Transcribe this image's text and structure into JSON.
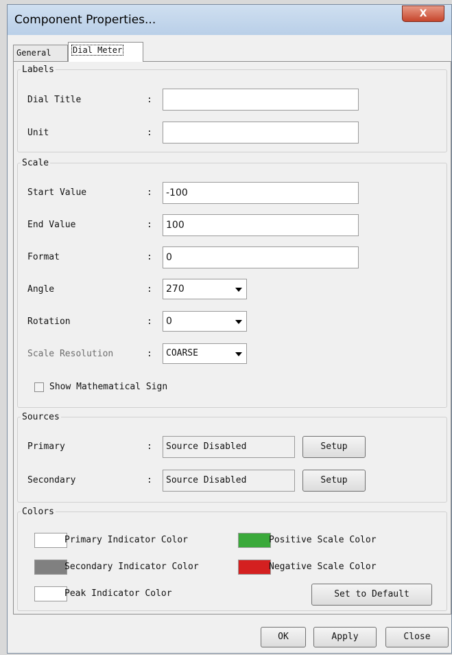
{
  "window": {
    "title": "Component Properties...",
    "close_glyph": "X"
  },
  "tabs": [
    {
      "label": "General",
      "active": false
    },
    {
      "label": "Dial Meter",
      "active": true
    }
  ],
  "labels_group": {
    "legend": "Labels",
    "dial_title": {
      "label": "Dial Title",
      "colon": ":",
      "value": ""
    },
    "unit": {
      "label": "Unit",
      "colon": ":",
      "value": ""
    }
  },
  "scale_group": {
    "legend": "Scale",
    "start_value": {
      "label": "Start Value",
      "colon": ":",
      "value": "-100"
    },
    "end_value": {
      "label": "End Value",
      "colon": ":",
      "value": "100"
    },
    "format": {
      "label": "Format",
      "colon": ":",
      "value": "0"
    },
    "angle": {
      "label": "Angle",
      "colon": ":",
      "value": "270"
    },
    "rotation": {
      "label": "Rotation",
      "colon": ":",
      "value": "0"
    },
    "scale_resolution": {
      "label": "Scale Resolution",
      "colon": ":",
      "value": "COARSE"
    },
    "show_sign": {
      "label": "Show Mathematical Sign",
      "checked": false
    }
  },
  "sources_group": {
    "legend": "Sources",
    "primary": {
      "label": "Primary",
      "colon": ":",
      "value": "Source Disabled",
      "button": "Setup"
    },
    "secondary": {
      "label": "Secondary",
      "colon": ":",
      "value": "Source Disabled",
      "button": "Setup"
    }
  },
  "colors_group": {
    "legend": "Colors",
    "primary_indicator": {
      "label": "Primary Indicator Color",
      "color": "#ffffff"
    },
    "secondary_indicator": {
      "label": "Secondary Indicator Color",
      "color": "#808080"
    },
    "peak_indicator": {
      "label": "Peak Indicator Color",
      "color": "#ffffff"
    },
    "positive_scale": {
      "label": "Positive Scale Color",
      "color": "#3aa93a"
    },
    "negative_scale": {
      "label": "Negative Scale Color",
      "color": "#d42020"
    },
    "default_button": "Set to Default"
  },
  "footer": {
    "ok": "OK",
    "apply": "Apply",
    "close": "Close"
  }
}
